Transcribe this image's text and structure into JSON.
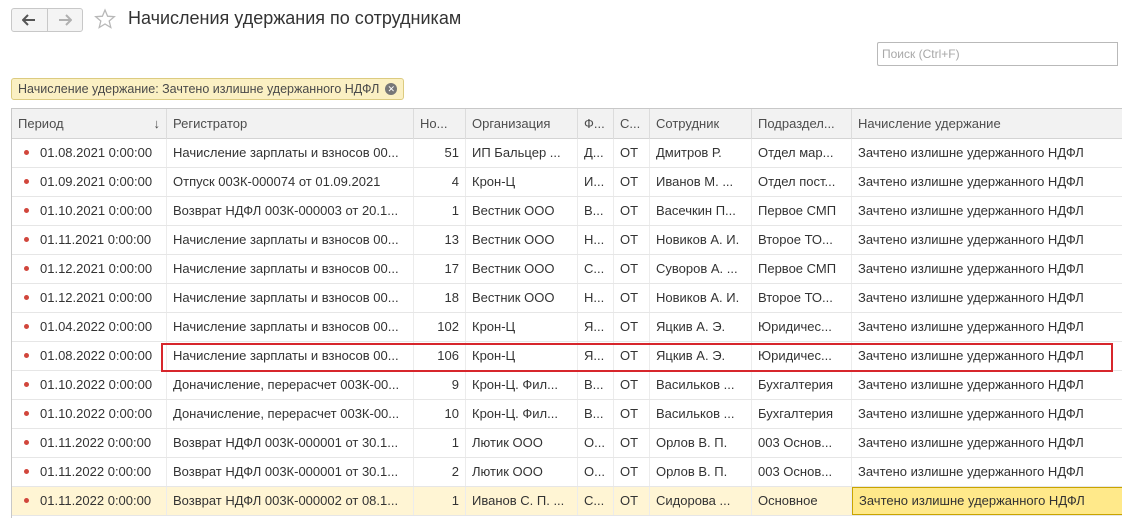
{
  "window": {
    "title": "Начисления удержания по сотрудникам"
  },
  "search": {
    "placeholder": "Поиск (Ctrl+F)"
  },
  "filter": {
    "label": "Начисление удержание: Зачтено излишне удержанного НДФЛ"
  },
  "table": {
    "columns": [
      "Период",
      "Регистратор",
      "Но...",
      "Организация",
      "Ф...",
      "С...",
      "Сотрудник",
      "Подраздел...",
      "Начисление удержание"
    ],
    "rows": [
      {
        "period": "01.08.2021 0:00:00",
        "registrar": "Начисление зарплаты и взносов 00...",
        "num": "51",
        "org": "ИП Бальцер ...",
        "f": "Д...",
        "s": "ОТ",
        "employee": "Дмитров Р.",
        "dept": "Отдел мар...",
        "accrual": "Зачтено излишне удержанного НДФЛ"
      },
      {
        "period": "01.09.2021 0:00:00",
        "registrar": "Отпуск 003К-000074 от 01.09.2021",
        "num": "4",
        "org": "Крон-Ц",
        "f": "И...",
        "s": "ОТ",
        "employee": "Иванов М. ...",
        "dept": "Отдел пост...",
        "accrual": "Зачтено излишне удержанного НДФЛ"
      },
      {
        "period": "01.10.2021 0:00:00",
        "registrar": "Возврат НДФЛ 003К-000003 от 20.1...",
        "num": "1",
        "org": "Вестник ООО",
        "f": "В...",
        "s": "ОТ",
        "employee": "Васечкин П...",
        "dept": "Первое СМП",
        "accrual": "Зачтено излишне удержанного НДФЛ"
      },
      {
        "period": "01.11.2021 0:00:00",
        "registrar": "Начисление зарплаты и взносов 00...",
        "num": "13",
        "org": "Вестник ООО",
        "f": "Н...",
        "s": "ОТ",
        "employee": "Новиков А. И.",
        "dept": "Второе ТО...",
        "accrual": "Зачтено излишне удержанного НДФЛ"
      },
      {
        "period": "01.12.2021 0:00:00",
        "registrar": "Начисление зарплаты и взносов 00...",
        "num": "17",
        "org": "Вестник ООО",
        "f": "С...",
        "s": "ОТ",
        "employee": "Суворов А. ...",
        "dept": "Первое СМП",
        "accrual": "Зачтено излишне удержанного НДФЛ"
      },
      {
        "period": "01.12.2021 0:00:00",
        "registrar": "Начисление зарплаты и взносов 00...",
        "num": "18",
        "org": "Вестник ООО",
        "f": "Н...",
        "s": "ОТ",
        "employee": "Новиков А. И.",
        "dept": "Второе ТО...",
        "accrual": "Зачтено излишне удержанного НДФЛ"
      },
      {
        "period": "01.04.2022 0:00:00",
        "registrar": "Начисление зарплаты и взносов 00...",
        "num": "102",
        "org": "Крон-Ц",
        "f": "Я...",
        "s": "ОТ",
        "employee": "Яцкив А. Э.",
        "dept": "Юридичес...",
        "accrual": "Зачтено излишне удержанного НДФЛ"
      },
      {
        "period": "01.08.2022 0:00:00",
        "registrar": "Начисление зарплаты и взносов 00...",
        "num": "106",
        "org": "Крон-Ц",
        "f": "Я...",
        "s": "ОТ",
        "employee": "Яцкив А. Э.",
        "dept": "Юридичес...",
        "accrual": "Зачтено излишне удержанного НДФЛ"
      },
      {
        "period": "01.10.2022 0:00:00",
        "registrar": "Доначисление, перерасчет 003К-00...",
        "num": "9",
        "org": "Крон-Ц. Фил...",
        "f": "В...",
        "s": "ОТ",
        "employee": "Васильков ...",
        "dept": "Бухгалтерия",
        "accrual": "Зачтено излишне удержанного НДФЛ"
      },
      {
        "period": "01.10.2022 0:00:00",
        "registrar": "Доначисление, перерасчет 003К-00...",
        "num": "10",
        "org": "Крон-Ц. Фил...",
        "f": "В...",
        "s": "ОТ",
        "employee": "Васильков ...",
        "dept": "Бухгалтерия",
        "accrual": "Зачтено излишне удержанного НДФЛ"
      },
      {
        "period": "01.11.2022 0:00:00",
        "registrar": "Возврат НДФЛ 003К-000001 от 30.1...",
        "num": "1",
        "org": "Лютик ООО",
        "f": "О...",
        "s": "ОТ",
        "employee": "Орлов В. П.",
        "dept": "003 Основ...",
        "accrual": "Зачтено излишне удержанного НДФЛ"
      },
      {
        "period": "01.11.2022 0:00:00",
        "registrar": "Возврат НДФЛ 003К-000001 от 30.1...",
        "num": "2",
        "org": "Лютик ООО",
        "f": "О...",
        "s": "ОТ",
        "employee": "Орлов В. П.",
        "dept": "003 Основ...",
        "accrual": "Зачтено излишне удержанного НДФЛ"
      },
      {
        "period": "01.11.2022 0:00:00",
        "registrar": "Возврат НДФЛ 003К-000002 от 08.1...",
        "num": "1",
        "org": "Иванов С. П. ...",
        "f": "С...",
        "s": "ОТ",
        "employee": "Сидорова ...",
        "dept": "Основное",
        "accrual": "Зачтено излишне удержанного НДФЛ"
      }
    ]
  },
  "icons": {
    "back": "arrow-left-icon",
    "forward": "arrow-right-icon",
    "favorite": "star-icon",
    "sort": "sort-arrow-icon",
    "row": "register-record-icon",
    "filter_close": "close-icon"
  },
  "colors": {
    "highlight_border": "#d7262c",
    "selected_row": "#fff5d4",
    "filter_tag": "#fbf0c3"
  }
}
